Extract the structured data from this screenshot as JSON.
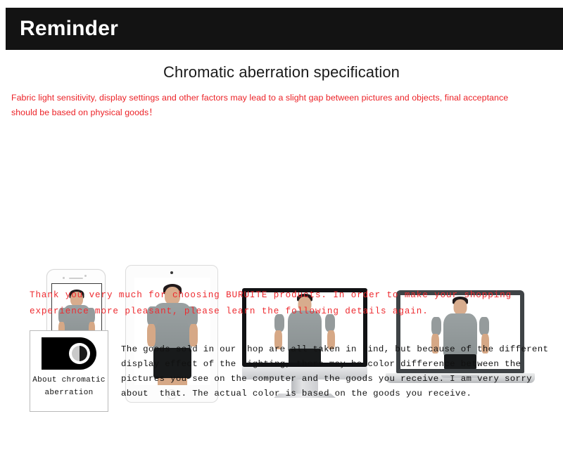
{
  "header": {
    "title": "Reminder",
    "background_color": "#131313",
    "text_color": "#ffffff"
  },
  "section": {
    "title": "Chromatic aberration specification",
    "intro_note": "Fabric light sensitivity, display settings and other factors may lead to a slight gap between pictures and objects, final acceptance should be based on physical goods！",
    "note_color": "#ec2227"
  },
  "devices": [
    {
      "name": "smartphone",
      "label": "phone"
    },
    {
      "name": "tablet",
      "label": "tablet"
    },
    {
      "name": "desktop-monitor",
      "label": "monitor"
    },
    {
      "name": "laptop",
      "label": "laptop"
    }
  ],
  "thanks": {
    "text": "Thank you very much for choosing BURUITE products. In order to make your shopping experience more pleasant, please learn the following details again.",
    "brand": "BURUITE",
    "color": "#ee2a2f"
  },
  "aberration": {
    "caption": "About chromatic aberration",
    "icon": "contrast-icon",
    "paragraph": "The goods sold in our shop are all taken in kind, but because of the different  display effect of the lighting, there may be color difference between the pictures you see on the computer and the goods you receive. I am very sorry about  that. The actual color is based on the goods you receive."
  }
}
